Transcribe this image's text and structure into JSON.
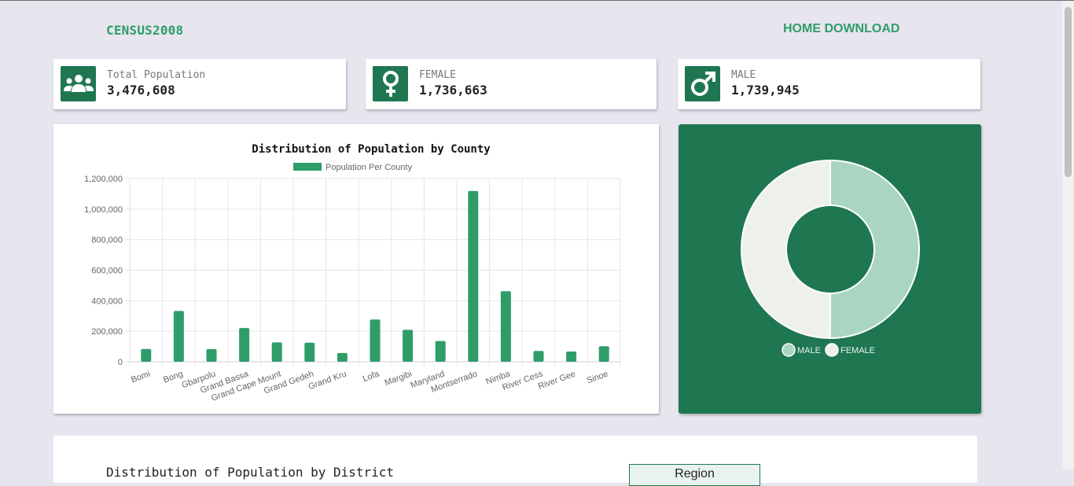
{
  "header": {
    "brand": "CENSUS2008",
    "nav": {
      "home": "HOME",
      "download": "DOWNLOAD"
    }
  },
  "stats": [
    {
      "label": "Total Population",
      "value": "3,476,608",
      "icon": "people-group-icon"
    },
    {
      "label": "FEMALE",
      "value": "1,736,663",
      "icon": "female-icon"
    },
    {
      "label": "MALE",
      "value": "1,739,945",
      "icon": "male-icon"
    }
  ],
  "colors": {
    "accent": "#2e9d6a",
    "dark_green": "#1f7752",
    "male": "#a9d5c1",
    "female": "#eef0ec"
  },
  "chart_data": [
    {
      "type": "bar",
      "title": "Distribution of Population by County",
      "categories": [
        "Bomi",
        "Bong",
        "Gbarpolu",
        "Grand Bassa",
        "Grand Cape Mount",
        "Grand Gedeh",
        "Grand Kru",
        "Lofa",
        "Margibi",
        "Maryland",
        "Montserrado",
        "Nimba",
        "River Cess",
        "River Gee",
        "Sinoe"
      ],
      "series": [
        {
          "name": "Population Per County",
          "values": [
            84000,
            333000,
            83000,
            221000,
            127000,
            125000,
            57000,
            277000,
            209000,
            136000,
            1118000,
            462000,
            71000,
            67000,
            102000
          ]
        }
      ],
      "ylim": [
        0,
        1200000
      ],
      "yticks": [
        "0",
        "200,000",
        "400,000",
        "600,000",
        "800,000",
        "1,000,000",
        "1,200,000"
      ],
      "grid": true,
      "legend": "top"
    },
    {
      "type": "pie",
      "variant": "doughnut",
      "categories": [
        "MALE",
        "FEMALE"
      ],
      "values": [
        1739945,
        1736663
      ],
      "legend": "bottom"
    }
  ],
  "bottom": {
    "title": "Distribution of Population by District",
    "button_label": "Region"
  }
}
